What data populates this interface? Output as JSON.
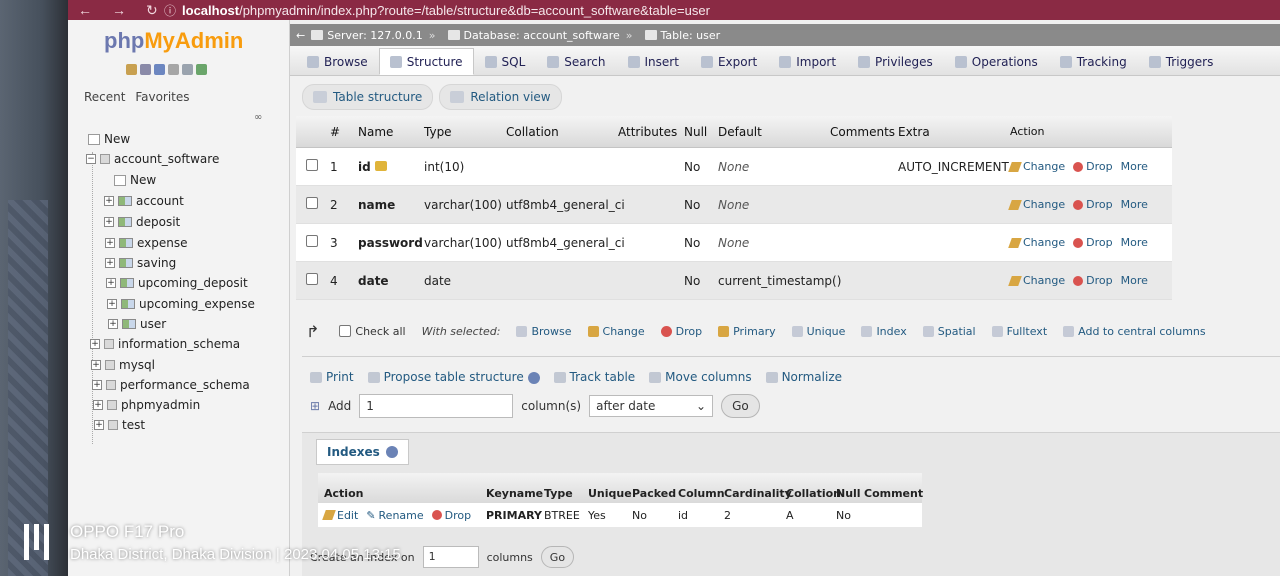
{
  "browser": {
    "url_host": "localhost",
    "url_path": "/phpmyadmin/index.php?route=/table/structure&db=account_software&table=user"
  },
  "nav": {
    "logo_php": "php",
    "logo_myadmin": "MyAdmin",
    "recent": "Recent",
    "favorites": "Favorites",
    "new_label": "New",
    "tree": [
      {
        "label": "account_software"
      },
      {
        "label": "New"
      },
      {
        "label": "account"
      },
      {
        "label": "deposit"
      },
      {
        "label": "expense"
      },
      {
        "label": "saving"
      },
      {
        "label": "upcoming_deposit"
      },
      {
        "label": "upcoming_expense"
      },
      {
        "label": "user"
      },
      {
        "label": "information_schema"
      },
      {
        "label": "mysql"
      },
      {
        "label": "performance_schema"
      },
      {
        "label": "phpmyadmin"
      },
      {
        "label": "test"
      }
    ]
  },
  "breadcrumb": {
    "server": "Server: 127.0.0.1",
    "database": "Database: account_software",
    "table": "Table: user"
  },
  "tabs": [
    "Browse",
    "Structure",
    "SQL",
    "Search",
    "Insert",
    "Export",
    "Import",
    "Privileges",
    "Operations",
    "Tracking",
    "Triggers"
  ],
  "active_tab": "Structure",
  "subtabs": [
    "Table structure",
    "Relation view"
  ],
  "columns_header": [
    "#",
    "Name",
    "Type",
    "Collation",
    "Attributes",
    "Null",
    "Default",
    "Comments",
    "Extra",
    "Action"
  ],
  "rows": [
    {
      "num": "1",
      "name": "id",
      "type": "int(10)",
      "collation": "",
      "attributes": "",
      "null": "No",
      "default": "None",
      "comments": "",
      "extra": "AUTO_INCREMENT"
    },
    {
      "num": "2",
      "name": "name",
      "type": "varchar(100)",
      "collation": "utf8mb4_general_ci",
      "attributes": "",
      "null": "No",
      "default": "None",
      "comments": "",
      "extra": ""
    },
    {
      "num": "3",
      "name": "password",
      "type": "varchar(100)",
      "collation": "utf8mb4_general_ci",
      "attributes": "",
      "null": "No",
      "default": "None",
      "comments": "",
      "extra": ""
    },
    {
      "num": "4",
      "name": "date",
      "type": "date",
      "collation": "",
      "attributes": "",
      "null": "No",
      "default": "current_timestamp()",
      "comments": "",
      "extra": ""
    }
  ],
  "row_actions": {
    "change": "Change",
    "drop": "Drop",
    "more": "More"
  },
  "with_selected": {
    "check_all": "Check all",
    "label": "With selected:",
    "items": [
      "Browse",
      "Change",
      "Drop",
      "Primary",
      "Unique",
      "Index",
      "Spatial",
      "Fulltext",
      "Add to central columns"
    ]
  },
  "tools": {
    "print": "Print",
    "propose": "Propose table structure",
    "track": "Track table",
    "move": "Move columns",
    "normalize": "Normalize"
  },
  "add": {
    "label": "Add",
    "value": "1",
    "columns_label": "column(s)",
    "position": "after date",
    "go": "Go"
  },
  "indexes": {
    "title": "Indexes",
    "action_header": "Action",
    "headers": [
      "Keyname",
      "Type",
      "Unique",
      "Packed",
      "Column",
      "Cardinality",
      "Collation",
      "Null",
      "Comment"
    ],
    "row": {
      "keyname": "PRIMARY",
      "type": "BTREE",
      "unique": "Yes",
      "packed": "No",
      "column": "id",
      "cardinality": "2",
      "collation": "A",
      "null": "No",
      "comment": ""
    },
    "actions": {
      "edit": "Edit",
      "rename": "Rename",
      "drop": "Drop"
    }
  },
  "create_index": {
    "label": "Create an index on",
    "value": "1",
    "columns_label": "columns",
    "go": "Go"
  },
  "watermark": {
    "brand": "OPPO F17 Pro",
    "location": "Dhaka District, Dhaka Division",
    "timestamp": "2023.04.05 13:15"
  },
  "colors": {
    "url_bar": "#8a2a44",
    "link": "#235a81",
    "logo_php": "#6c78af",
    "logo_myadmin": "#f89c0e"
  }
}
